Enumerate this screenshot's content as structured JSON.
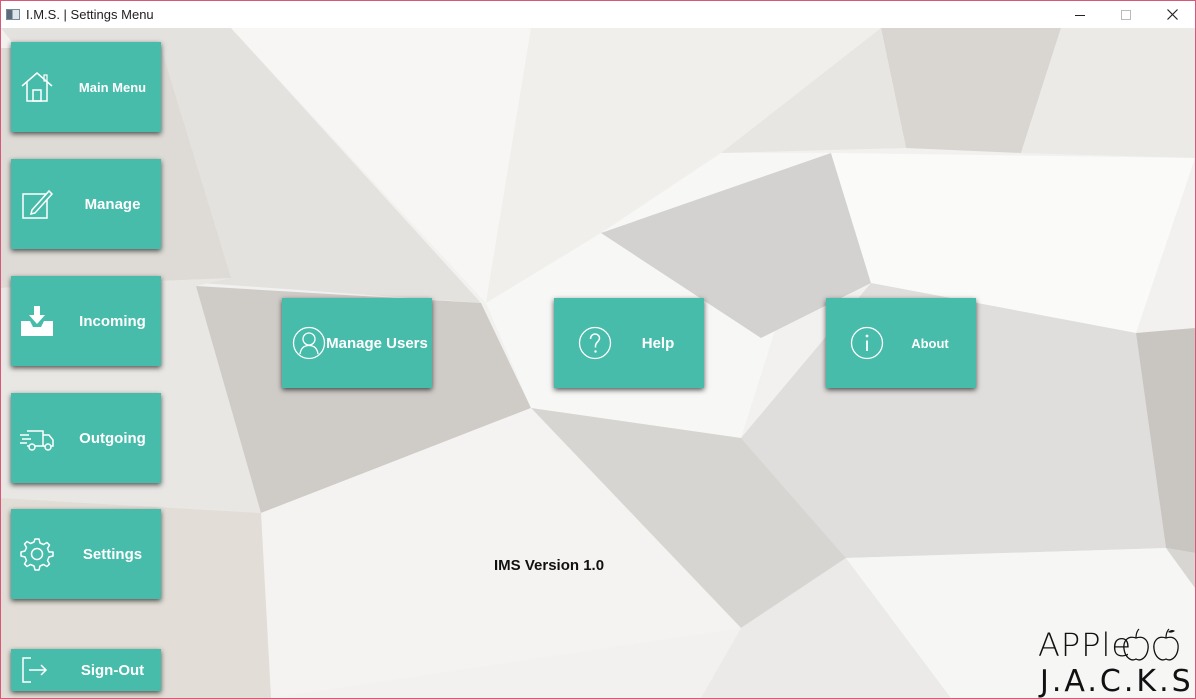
{
  "window": {
    "title": "I.M.S. | Settings Menu",
    "controls": [
      "minimize",
      "maximize",
      "close"
    ]
  },
  "sidebar": {
    "items": [
      {
        "label": "Main Menu",
        "icon": "home-icon"
      },
      {
        "label": "Manage",
        "icon": "edit-icon"
      },
      {
        "label": "Incoming",
        "icon": "inbox-download-icon"
      },
      {
        "label": "Outgoing",
        "icon": "delivery-truck-icon"
      },
      {
        "label": "Settings",
        "icon": "gear-icon"
      },
      {
        "label": "Sign-Out",
        "icon": "sign-out-icon"
      }
    ]
  },
  "main": {
    "buttons": [
      {
        "label": "Manage Users",
        "icon": "user-icon"
      },
      {
        "label": "Help",
        "icon": "question-icon"
      },
      {
        "label": "About",
        "icon": "info-icon"
      }
    ],
    "version": "IMS Version 1.0"
  },
  "logo": {
    "line1": "APPle",
    "line2": "J.A.C.K.S."
  },
  "colors": {
    "accent": "#47bcaa",
    "window_border": "#d8587a"
  }
}
